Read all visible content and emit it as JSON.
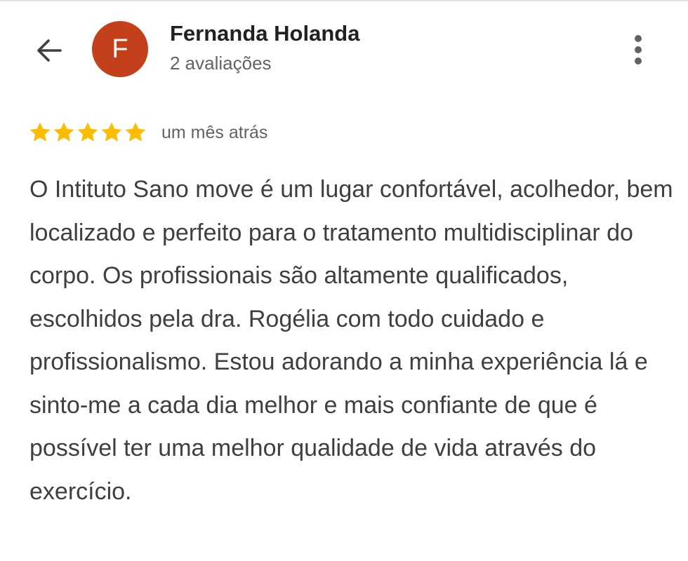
{
  "reviewer": {
    "initial": "F",
    "name": "Fernanda Holanda",
    "review_count": "2 avaliações",
    "avatar_color": "#c4401a"
  },
  "icons": {
    "back": "arrow-back-icon",
    "more": "more-vertical-icon",
    "star": "star-icon"
  },
  "review": {
    "rating": 5,
    "max_rating": 5,
    "star_color": "#fbbc04",
    "time": "um mês atrás",
    "text": "O Intituto Sano move é um lugar confortável, acolhedor, bem localizado e perfeito para o tratamento multidisciplinar do corpo. Os profissionais são altamente qualificados, escolhidos pela dra. Rogélia com todo cuidado e profissionalismo. Estou adorando a minha experiência lá e sinto-me a cada dia melhor e mais confiante de que é possível ter uma melhor qualidade de vida através do exercício."
  }
}
